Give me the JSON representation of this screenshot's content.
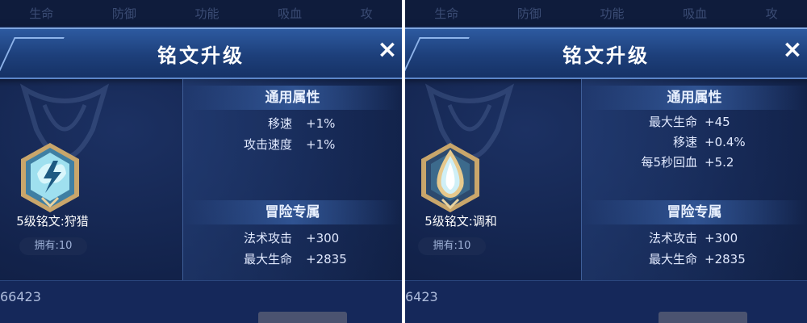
{
  "left": {
    "bg_tabs": [
      "生命",
      "防御",
      "功能",
      "吸血",
      "攻"
    ],
    "title": "铭文升级",
    "close": "×",
    "rune": {
      "name": "5级铭文:狩猎",
      "owned": "拥有:10",
      "icon": "lightning-rune-icon"
    },
    "general_header": "通用属性",
    "general": [
      {
        "label": "移速",
        "value": "+1%"
      },
      {
        "label": "攻击速度",
        "value": "+1%"
      }
    ],
    "adventure_header": "冒险专属",
    "adventure": [
      {
        "label": "法术攻击",
        "value": "+300"
      },
      {
        "label": "最大生命",
        "value": "+2835"
      }
    ],
    "bottom_number": "66423"
  },
  "right": {
    "bg_tabs": [
      "生命",
      "防御",
      "功能",
      "吸血",
      "攻"
    ],
    "title": "铭文升级",
    "close": "×",
    "rune": {
      "name": "5级铭文:调和",
      "owned": "拥有:10",
      "icon": "teardrop-rune-icon"
    },
    "general_header": "通用属性",
    "general": [
      {
        "label": "最大生命",
        "value": "+45"
      },
      {
        "label": "移速",
        "value": "+0.4%"
      },
      {
        "label": "每5秒回血",
        "value": "+5.2"
      }
    ],
    "adventure_header": "冒险专属",
    "adventure": [
      {
        "label": "法术攻击",
        "value": "+300"
      },
      {
        "label": "最大生命",
        "value": "+2835"
      }
    ],
    "bottom_number": "6423"
  },
  "colors": {
    "gold": "#c9a66b",
    "panel_blue": "#12224a",
    "title_blue": "#2d5aa0"
  }
}
